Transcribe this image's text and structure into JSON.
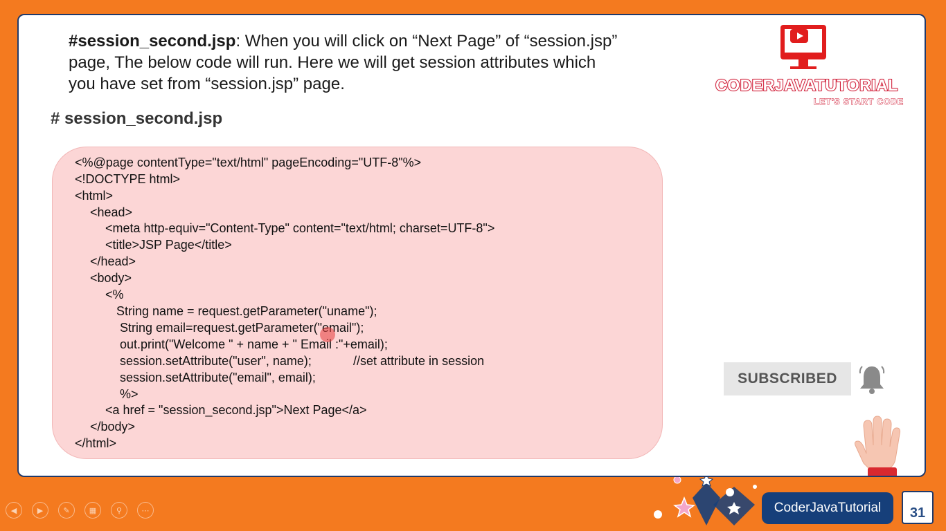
{
  "intro": {
    "bold": "#session_second.jsp",
    "line1_rest": ": When you will click on “Next Page” of “session.jsp”",
    "line2": "page, The below code will run. Here we will get session attributes which",
    "line3": "you have set from “session.jsp” page."
  },
  "heading": "# session_second.jsp",
  "code_lines": [
    "<%@page contentType=\"text/html\" pageEncoding=\"UTF-8\"%>",
    "<!DOCTYPE html>",
    "<html>",
    "<head>",
    "<meta http-equiv=\"Content-Type\" content=\"text/html; charset=UTF-8\">",
    "<title>JSP Page</title>",
    "</head>",
    "<body>",
    "<%",
    "String name = request.getParameter(\"uname\");",
    "String email=request.getParameter(\"email\");",
    "out.print(\"Welcome \" + name + \" Email :\"+email);",
    "session.setAttribute(\"user\", name);",
    "//set attribute in session",
    "session.setAttribute(\"email\", email);",
    "%>",
    "<a href = \"session_second.jsp\">Next Page</a>",
    "</body>",
    "</html>"
  ],
  "logo": {
    "title": "CODERJAVATUTORIAL",
    "tagline": "LET'S START CODE"
  },
  "subscribe_label": "SUBSCRIBED",
  "footer": {
    "brand": "CoderJavaTutorial",
    "slide_number": "31"
  },
  "colors": {
    "frame_orange": "#f47a1f",
    "code_bg": "#fcd6d6",
    "brand_navy": "#163f7a",
    "logo_red": "#e11d1d"
  },
  "icons": [
    "play-icon",
    "bell-icon",
    "hand-icon",
    "prev-icon",
    "next-icon",
    "pen-icon",
    "slides-icon",
    "zoom-icon",
    "more-icon"
  ]
}
